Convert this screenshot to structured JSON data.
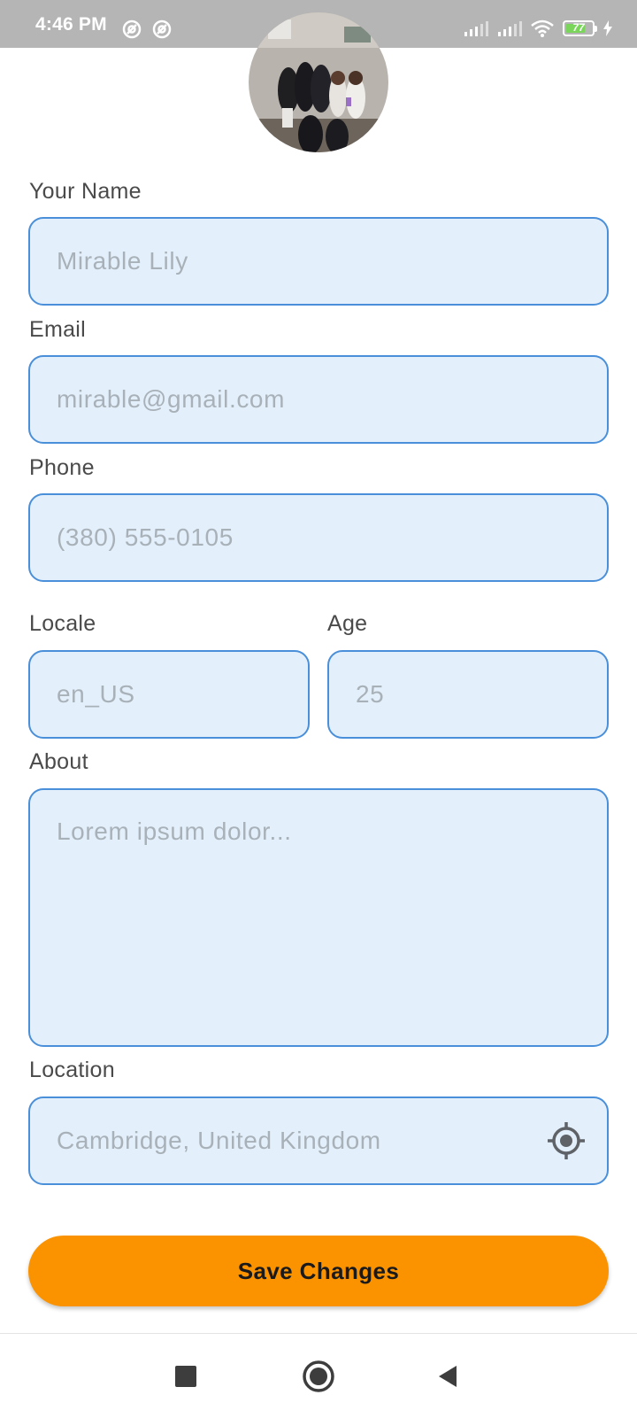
{
  "status_bar": {
    "time": "4:46 PM",
    "battery": "77",
    "battery_level": 0.77
  },
  "profile": {
    "avatar_icon": "profile-photo"
  },
  "form": {
    "name": {
      "label": "Your Name",
      "placeholder": "Mirable Lily"
    },
    "email": {
      "label": "Email",
      "placeholder": "mirable@gmail.com"
    },
    "phone": {
      "label": "Phone",
      "placeholder": "(380) 555-0105"
    },
    "locale": {
      "label": "Locale",
      "placeholder": "en_US"
    },
    "age": {
      "label": "Age",
      "placeholder": "25"
    },
    "about": {
      "label": "About",
      "placeholder": "Lorem ipsum dolor..."
    },
    "location": {
      "label": "Location",
      "placeholder": "Cambridge, United Kingdom",
      "icon": "my-location-icon"
    },
    "save_label": "Save Changes"
  },
  "colors": {
    "field_bg": "#e3f0fc",
    "field_border": "#4a8fd9",
    "accent": "#fb9300",
    "status_bar_bg": "#b5b5b5"
  },
  "nav": {
    "icons": [
      "recents-square-icon",
      "home-circle-icon",
      "back-triangle-icon"
    ]
  }
}
